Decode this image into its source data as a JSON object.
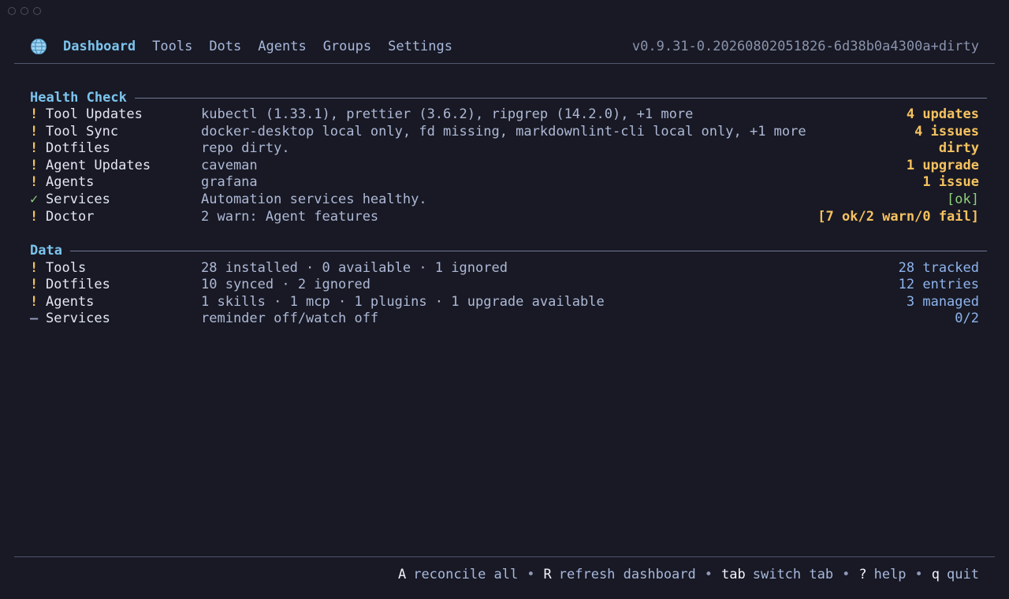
{
  "nav": {
    "tabs": [
      "Dashboard",
      "Tools",
      "Dots",
      "Agents",
      "Groups",
      "Settings"
    ],
    "active": "Dashboard",
    "version": "v0.9.31-0.20260802051826-6d38b0a4300a+dirty"
  },
  "health": {
    "title": "Health Check",
    "rows": [
      {
        "mark": "!",
        "name": "Tool Updates",
        "detail": "kubectl (1.33.1), prettier (3.6.2), ripgrep (14.2.0), +1 more",
        "status": "4 updates"
      },
      {
        "mark": "!",
        "name": "Tool Sync",
        "detail": "docker-desktop local only, fd missing, markdownlint-cli local only, +1 more",
        "status": "4 issues"
      },
      {
        "mark": "!",
        "name": "Dotfiles",
        "detail": "repo dirty.",
        "status": "dirty"
      },
      {
        "mark": "!",
        "name": "Agent Updates",
        "detail": "caveman",
        "status": "1 upgrade"
      },
      {
        "mark": "!",
        "name": "Agents",
        "detail": "grafana",
        "status": "1 issue"
      },
      {
        "mark": "✓",
        "name": "Services",
        "detail": "Automation services healthy.",
        "status": "[ok]"
      },
      {
        "mark": "!",
        "name": "Doctor",
        "detail": "2 warn: Agent features",
        "status": "[7 ok/2 warn/0 fail]"
      }
    ]
  },
  "data_section": {
    "title": "Data",
    "rows": [
      {
        "mark": "!",
        "name": "Tools",
        "detail": "28 installed · 0 available · 1 ignored",
        "status": "28 tracked"
      },
      {
        "mark": "!",
        "name": "Dotfiles",
        "detail": "10 synced · 2 ignored",
        "status": "12 entries"
      },
      {
        "mark": "!",
        "name": "Agents",
        "detail": "1 skills · 1 mcp · 1 plugins · 1 upgrade available",
        "status": "3 managed"
      },
      {
        "mark": "—",
        "name": "Services",
        "detail": "reminder off/watch off",
        "status": "0/2"
      }
    ]
  },
  "footer": {
    "shortcuts": [
      {
        "key": "A",
        "desc": "reconcile all"
      },
      {
        "key": "R",
        "desc": "refresh dashboard"
      },
      {
        "key": "tab",
        "desc": "switch tab"
      },
      {
        "key": "?",
        "desc": "help"
      },
      {
        "key": "q",
        "desc": "quit"
      }
    ],
    "separator": "•"
  },
  "colors": {
    "background": "#181924",
    "accent": "#7cc4ee",
    "warning": "#f6c260",
    "ok": "#8fd17a",
    "info": "#8eb4ee"
  },
  "icons": {
    "logo": "globe-icon"
  }
}
